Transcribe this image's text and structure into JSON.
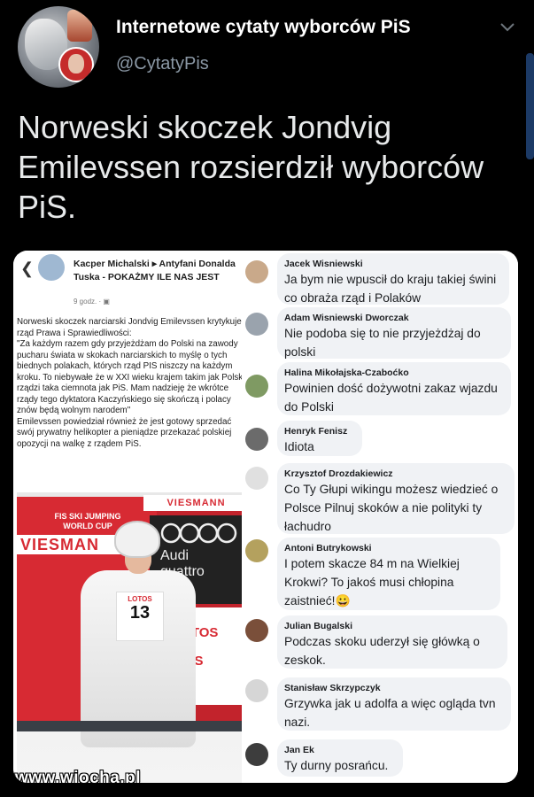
{
  "account": {
    "name": "Internetowe cytaty wyborców PiS",
    "handle": "@CytatyPis"
  },
  "tweet": {
    "text": "Norweski skoczek Jondvig Emilevssen rozsierdził wyborców PiS."
  },
  "post": {
    "author": "Kacper Michalski ▸ Antyfani Donalda Tuska - POKAŻMY ILE NAS JEST",
    "time": "9 godz. · ▣",
    "body": "Norweski skoczek narciarski Jondvig Emilevssen krytykuje rząd Prawa i Sprawiedliwości:\n\"Za każdym razem gdy przyjeżdżam do Polski na zawody pucharu świata w skokach narciarskich to myślę o tych biednych polakach, których rząd PIS niszczy na każdym kroku. To niebywałe że w XXI wieku krajem takim jak Polska rządzi taka ciemnota jak PiS. Mam nadzieję że wkrótce rządy tego dyktatora Kaczyńskiego się skończą i polacy znów będą wolnym narodem\"\nEmilevssen powiedział również że jest gotowy sprzedać swój prywatny helikopter a pieniądze przekazać polskiej opozycji na walkę z rządem PiS."
  },
  "photo": {
    "viessmann_small": "VIESMANN",
    "fis_line1": "FIS SKI JUMPING",
    "fis_line2": "WORLD CUP",
    "viessmann_big": "VIESMAN",
    "audi_line1": "Audi",
    "audi_line2": "quattro",
    "lotos": "LOTOS",
    "lotos_2": "TOS",
    "bib_brand": "LOTOS",
    "bib_number": "13"
  },
  "watermark": "www.wiocha.pl",
  "comments": [
    {
      "name": "Jacek Wisniewski",
      "text": "Ja bym nie wpuscił do kraju takiej świni co obraża rząd i Polaków"
    },
    {
      "name": "Adam Wisniewski Dworczak",
      "text": "Nie podoba się to nie przyjeżdżaj do polski"
    },
    {
      "name": "Halina Mikołajska-Czabоćko",
      "text": "Powinien dość dożywotni zakaz wjazdu do Polski"
    },
    {
      "name": "Henryk Fenisz",
      "text": "Idiota"
    },
    {
      "name": "Krzysztof Drozdakiewicz",
      "text": "Co Ty Głupi wikingu możesz wiedzieć o Polsce Pilnuj skoków a nie polityki ty łachudro"
    },
    {
      "name": "Antoni Butrykowski",
      "text": "I potem skacze 84 m na Wielkiej Krokwi? To jakoś musi chłopina zaistnieć!😀"
    },
    {
      "name": "Julian Bugalski",
      "text": "Podczas skoku uderzył się główką o zeskok."
    },
    {
      "name": "Stanisław Skrzypczyk",
      "text": "Grzywka jak u adolfa a więc ogląda tvn nazi."
    },
    {
      "name": "Jan Ek",
      "text": "Ty durny posrańcu."
    }
  ]
}
